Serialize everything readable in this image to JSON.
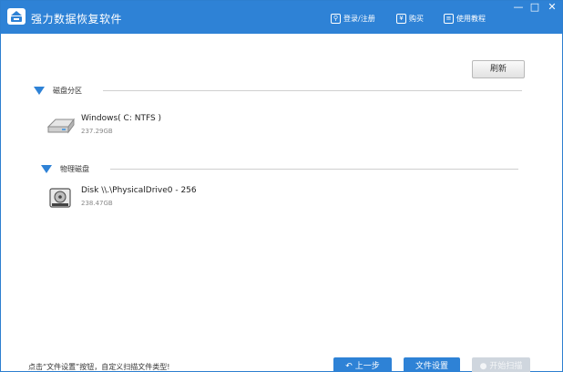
{
  "titlebar": {
    "app_title": "强力数据恢复软件",
    "login_label": "登录/注册",
    "buy_label": "购买",
    "tutorial_label": "使用教程",
    "minimize_glyph": "—",
    "maximize_glyph": "□",
    "close_glyph": "✕"
  },
  "toolbar": {
    "refresh_label": "刷新"
  },
  "sections": [
    {
      "label": "磁盘分区",
      "drives": [
        {
          "name": "Windows( C: NTFS )",
          "size": "237.29GB"
        }
      ]
    },
    {
      "label": "物理磁盘",
      "drives": [
        {
          "name": "Disk \\\\.\\PhysicalDrive0 - 256",
          "size": "238.47GB"
        }
      ]
    }
  ],
  "footer": {
    "hint": "点击“文件设置”按钮，自定义扫描文件类型!",
    "back_label": "上一步",
    "file_settings_label": "文件设置",
    "start_scan_label": "开始扫描"
  },
  "colors": {
    "accent": "#2e82d6",
    "disabled": "#cfd6de"
  }
}
